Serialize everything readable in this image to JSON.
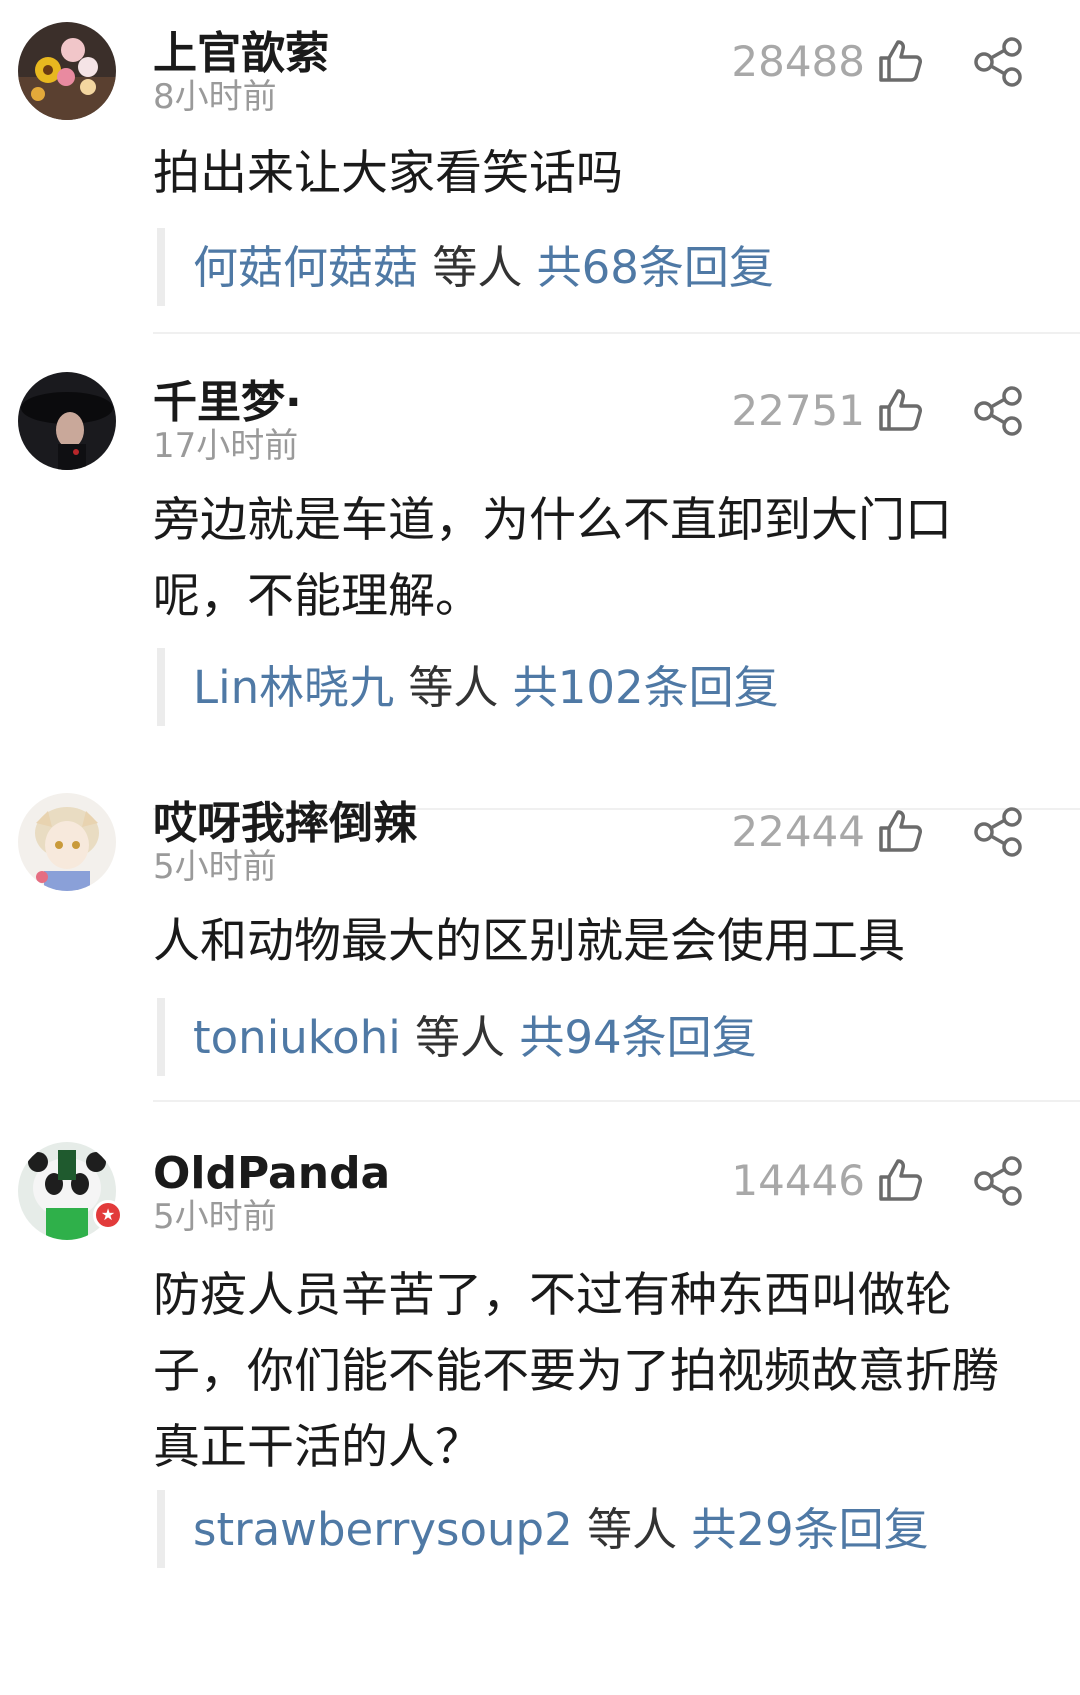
{
  "comments": [
    {
      "username": "上官歆萦",
      "time": "8小时前",
      "likes": "28488",
      "text": "拍出来让大家看笑话吗",
      "reply": {
        "names": "何菇何菇菇",
        "mid": " 等人 ",
        "count": "共68条回复"
      }
    },
    {
      "username": "千里梦·",
      "time": "17小时前",
      "likes": "22751",
      "text": "旁边就是车道，为什么不直卸到大门口呢，不能理解。",
      "reply": {
        "names": "Lin林晓九",
        "mid": " 等人 ",
        "count": "共102条回复"
      }
    },
    {
      "username": "哎呀我摔倒辣",
      "time": "5小时前",
      "likes": "22444",
      "text": "人和动物最大的区别就是会使用工具",
      "reply": {
        "names": "toniukohi",
        "mid": " 等人 ",
        "count": "共94条回复"
      }
    },
    {
      "username": "OldPanda",
      "time": "5小时前",
      "likes": "14446",
      "text": "防疫人员辛苦了，不过有种东西叫做轮子，你们能不能不要为了拍视频故意折腾真正干活的人？",
      "reply": {
        "names": "strawberrysoup2",
        "mid": " 等人 ",
        "count": "共29条回复"
      }
    }
  ],
  "icons": {
    "like": "thumbs-up-icon",
    "share": "share-icon"
  }
}
